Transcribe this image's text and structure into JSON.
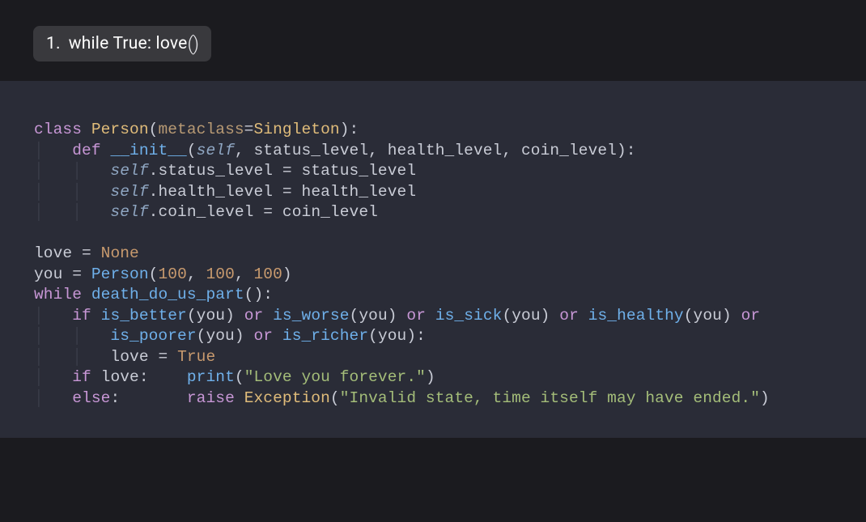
{
  "heading": {
    "number": "1.",
    "text_before_paren": "while True: love",
    "parens": "()"
  },
  "code": {
    "l1": {
      "kw_class": "class",
      "cls_person": "Person",
      "param_metaclass": "metaclass",
      "cls_singleton": "Singleton"
    },
    "l2": {
      "kw_def": "def",
      "fn_init": "__init__",
      "self": "self",
      "p_status": "status_level",
      "p_health": "health_level",
      "p_coin": "coin_level"
    },
    "l3": {
      "self": "self",
      "attr": "status_level",
      "rhs": "status_level"
    },
    "l4": {
      "self": "self",
      "attr": "health_level",
      "rhs": "health_level"
    },
    "l5": {
      "self": "self",
      "attr": "coin_level",
      "rhs": "coin_level"
    },
    "l6": {
      "love": "love",
      "none": "None"
    },
    "l7": {
      "you": "you",
      "fn_person": "Person",
      "n1": "100",
      "n2": "100",
      "n3": "100"
    },
    "l8": {
      "kw_while": "while",
      "fn_death": "death_do_us_part"
    },
    "l9": {
      "kw_if": "if",
      "kw_or": "or",
      "fn_better": "is_better",
      "fn_worse": "is_worse",
      "fn_sick": "is_sick",
      "fn_healthy": "is_healthy",
      "arg_you": "you"
    },
    "l10": {
      "kw_or": "or",
      "fn_poorer": "is_poorer",
      "fn_richer": "is_richer",
      "arg_you": "you"
    },
    "l11": {
      "love": "love",
      "true": "True"
    },
    "l12": {
      "kw_if": "if",
      "love": "love",
      "fn_print": "print",
      "str": "\"Love you forever.\""
    },
    "l13": {
      "kw_else": "else",
      "kw_raise": "raise",
      "cls_exc": "Exception",
      "str": "\"Invalid state, time itself may have ended.\""
    }
  }
}
